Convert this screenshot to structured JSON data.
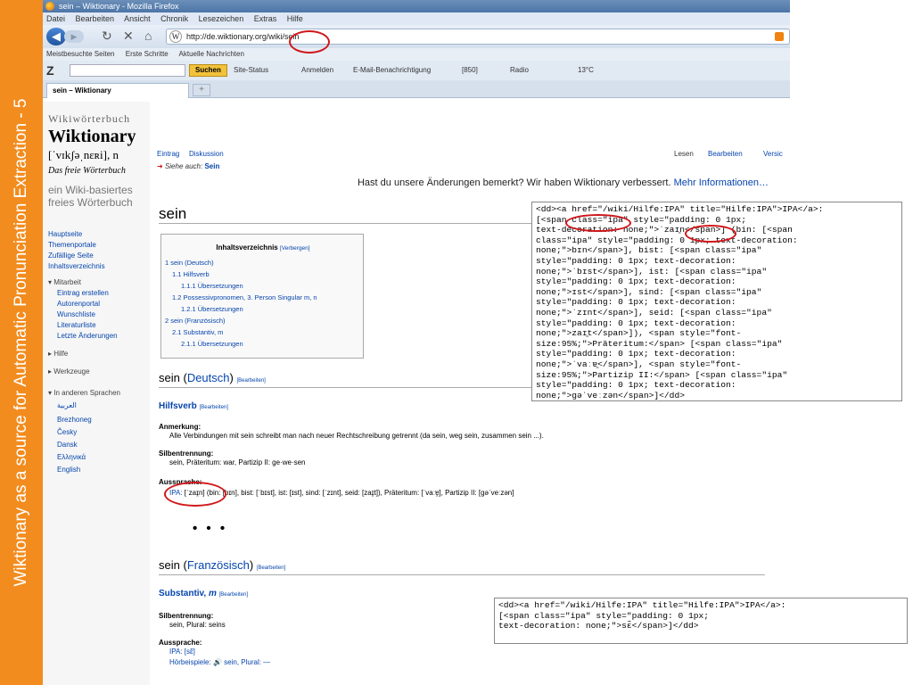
{
  "slide": {
    "side_title": "Wiktionary as a source for Automatic Pronunciation Extraction - 5",
    "accent": "#f28c1e"
  },
  "browser": {
    "window_title": "sein – Wiktionary - Mozilla Firefox",
    "menu": [
      "Datei",
      "Bearbeiten",
      "Ansicht",
      "Chronik",
      "Lesezeichen",
      "Extras",
      "Hilfe"
    ],
    "url": "http://de.wiktionary.org/wiki/sein",
    "bookmarks": [
      "Meistbesuchte Seiten",
      "Erste Schritte",
      "Aktuelle Nachrichten"
    ],
    "toolbar": {
      "logo": "Z",
      "search_button": "Suchen",
      "items": [
        "Site-Status",
        "Anmelden",
        "E-Mail-Benachrichtigung",
        "[850]",
        "Radio",
        "13°C"
      ]
    },
    "tab_title": "sein – Wiktionary",
    "new_tab": "+"
  },
  "sidebar": {
    "logo_small": "Wikiwörterbuch",
    "logo_title": "Wiktionary",
    "logo_ipa": "[ˈvɪkʃəˌnɛʀi], n",
    "logo_tagline": "Das freie Wörterbuch",
    "logo_desc": "ein Wiki-basiertes freies Wörterbuch",
    "nav": [
      "Hauptseite",
      "Themenportale",
      "Zufällige Seite",
      "Inhaltsverzeichnis"
    ],
    "mitarbeit_label": "Mitarbeit",
    "mitarbeit": [
      "Eintrag erstellen",
      "Autorenportal",
      "Wunschliste",
      "Literaturliste",
      "Letzte Änderungen"
    ],
    "hilfe": "Hilfe",
    "werkzeuge": "Werkzeuge",
    "languages_label": "In anderen Sprachen",
    "languages": [
      "العربية",
      "Brezhoneg",
      "Česky",
      "Dansk",
      "Ελληνικά",
      "English"
    ]
  },
  "page": {
    "tabs_left": [
      "Eintrag",
      "Diskussion"
    ],
    "tabs_right": [
      "Lesen",
      "Bearbeiten",
      "Versic"
    ],
    "siehe_auch_label": "Siehe auch:",
    "siehe_auch_link": "Sein",
    "notice": "Hast du unsere Änderungen bemerkt? Wir haben Wiktionary verbessert.",
    "notice_link": "Mehr Informationen…",
    "title": "sein",
    "toc": {
      "title": "Inhaltsverzeichnis",
      "hide": "[Verbergen]",
      "items": [
        "1 sein (Deutsch)",
        "1.1 Hilfsverb",
        "1.1.1 Übersetzungen",
        "1.2 Possessivpronomen, 3. Person Singular m, n",
        "1.2.1 Übersetzungen",
        "2 sein (Französisch)",
        "2.1 Substantiv, m",
        "2.1.1 Übersetzungen"
      ]
    },
    "edit": "[Bearbeiten]",
    "de": {
      "head_word": "sein",
      "head_lang": "Deutsch",
      "pos": "Hilfsverb",
      "anmerkung_label": "Anmerkung:",
      "anmerkung": "Alle Verbindungen mit sein schreibt man nach neuer Rechtschreibung getrennt (da sein, weg sein, zusammen sein ...).",
      "silben_label": "Silbentrennung:",
      "silben": "sein, Präteritum: war, Partizip II: ge·we·sen",
      "aussprache_label": "Aussprache:",
      "ipa_link": "IPA:",
      "ipa_value": "[ˈzaɪ̯n]",
      "ipa_rest": "(bin: [bɪn], bist: [ˈbɪst], ist: [ɪst], sind: [ˈzɪnt], seid: [zaɪ̯t]), Präteritum: [ˈvaːɐ̯], Partizip II: [ɡəˈveːzən]"
    },
    "ellipsis": "• • •",
    "fr": {
      "head_word": "sein",
      "head_lang": "Französisch",
      "pos": "Substantiv, ",
      "gender": "m",
      "silben_label": "Silbentrennung:",
      "silben": "sein, Plural: seins",
      "aussprache_label": "Aussprache:",
      "ipa": "IPA: [sɛ̃]",
      "hoer_label": "Hörbeispiele:",
      "hoer_rest": "sein, Plural: —"
    }
  },
  "code_top": [
    "<dd><a href=\"/wiki/Hilfe:IPA\" title=\"Hilfe:IPA\">IPA</a>:",
    "[<span class=\"ipa\" style=\"padding: 0 1px;",
    "text-decoration: none;\">ˈzaɪ̯n</span>] (bin: [<span",
    "class=\"ipa\" style=\"padding: 0 1px; text-decoration:",
    "none;\">bɪn</span>], bist: [<span class=\"ipa\"",
    "style=\"padding: 0 1px; text-decoration:",
    "none;\">ˈbɪst</span>], ist: [<span class=\"ipa\"",
    "style=\"padding: 0 1px; text-decoration:",
    "none;\">ɪst</span>], sind: [<span class=\"ipa\"",
    "style=\"padding: 0 1px; text-decoration:",
    "none;\">ˈzɪnt</span>], seid: [<span class=\"ipa\"",
    "style=\"padding: 0 1px; text-decoration:",
    "none;\">zaɪ̯t</span>]), <span style=\"font-",
    "size:95%;\">Präteritum:</span> [<span class=\"ipa\"",
    "style=\"padding: 0 1px; text-decoration:",
    "none;\">ˈvaːɐ̯</span>], <span style=\"font-",
    "size:95%;\">Partizip II:</span> [<span class=\"ipa\"",
    "style=\"padding: 0 1px; text-decoration:",
    "none;\">ɡəˈveːzən</span>]</dd>"
  ],
  "code_bottom": [
    "<dd><a href=\"/wiki/Hilfe:IPA\" title=\"Hilfe:IPA\">IPA</a>:",
    "[<span class=\"ipa\" style=\"padding: 0 1px;",
    "text-decoration: none;\">sɛ̃</span>]</dd>"
  ]
}
